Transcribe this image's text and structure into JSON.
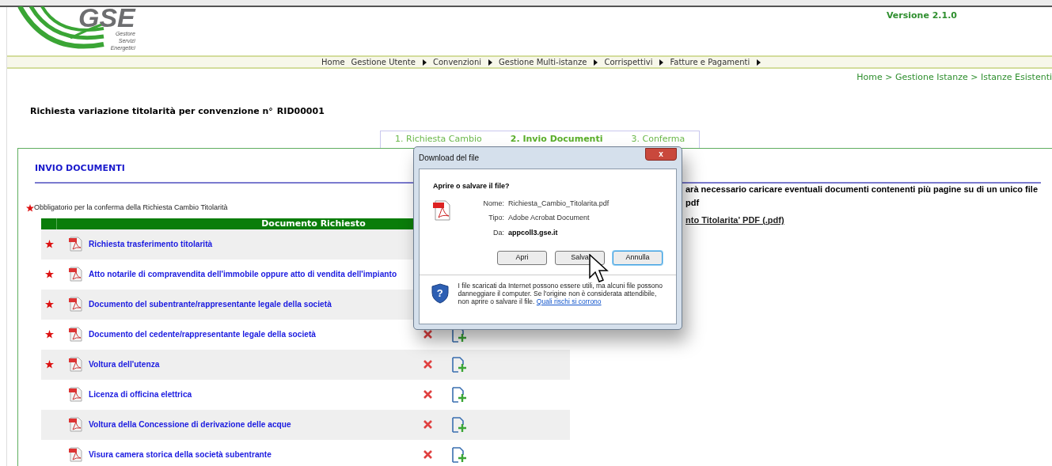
{
  "header": {
    "logo_text": "GSE",
    "logo_subtitle": [
      "Gestore",
      "Servizi",
      "Energetici"
    ],
    "version": "Versione 2.1.0"
  },
  "nav": [
    {
      "label": "Home",
      "submenu": false
    },
    {
      "label": "Gestione Utente",
      "submenu": true
    },
    {
      "label": "Convenzioni",
      "submenu": true
    },
    {
      "label": "Gestione Multi-istanze",
      "submenu": true
    },
    {
      "label": "Corrispettivi",
      "submenu": true
    },
    {
      "label": "Fatture e Pagamenti",
      "submenu": true
    }
  ],
  "breadcrumb": "Home > Gestione Istanze > Istanze Esistenti",
  "page_title": {
    "label": "Richiesta variazione titolarità per convenzione n°",
    "code": "RID00001"
  },
  "steps": [
    {
      "label": "1. Richiesta Cambio",
      "selected": false
    },
    {
      "label": "2. Invio Documenti",
      "selected": true
    },
    {
      "label": "3. Conferma",
      "selected": false
    }
  ],
  "panel": {
    "title": "INVIO DOCUMENTI",
    "required_note": "Obbligatorio per la conferma della Richiesta Cambio Titolarità",
    "column": "Documento Richiesto",
    "rows": [
      {
        "name": "Richiesta trasferimento titolarità",
        "required": true,
        "actions_covered": true
      },
      {
        "name": "Atto notarile di compravendita dell'immobile oppure atto di vendita dell'impianto",
        "required": true,
        "actions_covered": true
      },
      {
        "name": "Documento del subentrante/rappresentante legale della società",
        "required": true,
        "actions_covered": true
      },
      {
        "name": "Documento del cedente/rappresentante legale della società",
        "required": true
      },
      {
        "name": "Voltura dell'utenza",
        "required": true
      },
      {
        "name": "Licenza di officina elettrica",
        "required": false
      },
      {
        "name": "Voltura della Concessione di derivazione delle acque",
        "required": false
      },
      {
        "name": "Visura camera storica della società subentrante",
        "required": false
      }
    ],
    "side_note": "arà necessario caricare eventuali documenti contenenti più pagine su di un unico file pdf",
    "side_link": "nto Titolarita' PDF (.pdf)"
  },
  "dialog": {
    "title": "Download del file",
    "close": "x",
    "question": "Aprire o salvare il file?",
    "fields": [
      {
        "label": "Nome:",
        "value": "Richiesta_Cambio_Titolarita.pdf",
        "bold": false
      },
      {
        "label": "Tipo:",
        "value": "Adobe Acrobat Document",
        "bold": false
      },
      {
        "label": "Da:",
        "value": "appcoll3.gse.it",
        "bold": true
      }
    ],
    "buttons": [
      {
        "label": "Apri",
        "focused": false
      },
      {
        "label": "Salva",
        "focused": false
      },
      {
        "label": "Annulla",
        "focused": true
      }
    ],
    "warning_icon": "?",
    "warning": "I file scaricati da Internet possono essere utili, ma alcuni file possono danneggiare il computer. Se l'origine non è considerata attendibile, non aprire o salvare il file.",
    "warning_link": "Quali rischi si corrono"
  }
}
